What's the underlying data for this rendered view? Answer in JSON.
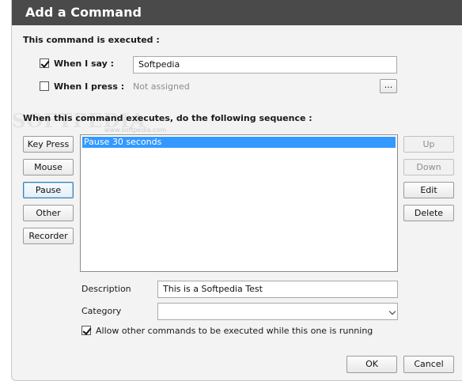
{
  "window": {
    "title": "Add a Command"
  },
  "trigger": {
    "heading": "This command is executed :",
    "say": {
      "label": "When I say :",
      "checked": true,
      "value": "Softpedia"
    },
    "press": {
      "label": "When I press :",
      "checked": false,
      "value": "Not assigned",
      "browse_label": "..."
    }
  },
  "sequence": {
    "heading": "When this command executes, do the following sequence :",
    "left_buttons": [
      "Key Press",
      "Mouse",
      "Pause",
      "Other",
      "Recorder"
    ],
    "items": [
      "Pause 30 seconds"
    ],
    "right_buttons": {
      "up": "Up",
      "down": "Down",
      "edit": "Edit",
      "delete": "Delete"
    }
  },
  "details": {
    "description_label": "Description",
    "description_value": "This is a Softpedia Test",
    "category_label": "Category",
    "category_value": "",
    "allow_label": "Allow other commands to be executed while this one is running",
    "allow_checked": true
  },
  "footer": {
    "ok_label": "OK",
    "cancel_label": "Cancel"
  },
  "watermark": {
    "text": "SOFTPEDIA",
    "small": "www.softpedia.com"
  }
}
